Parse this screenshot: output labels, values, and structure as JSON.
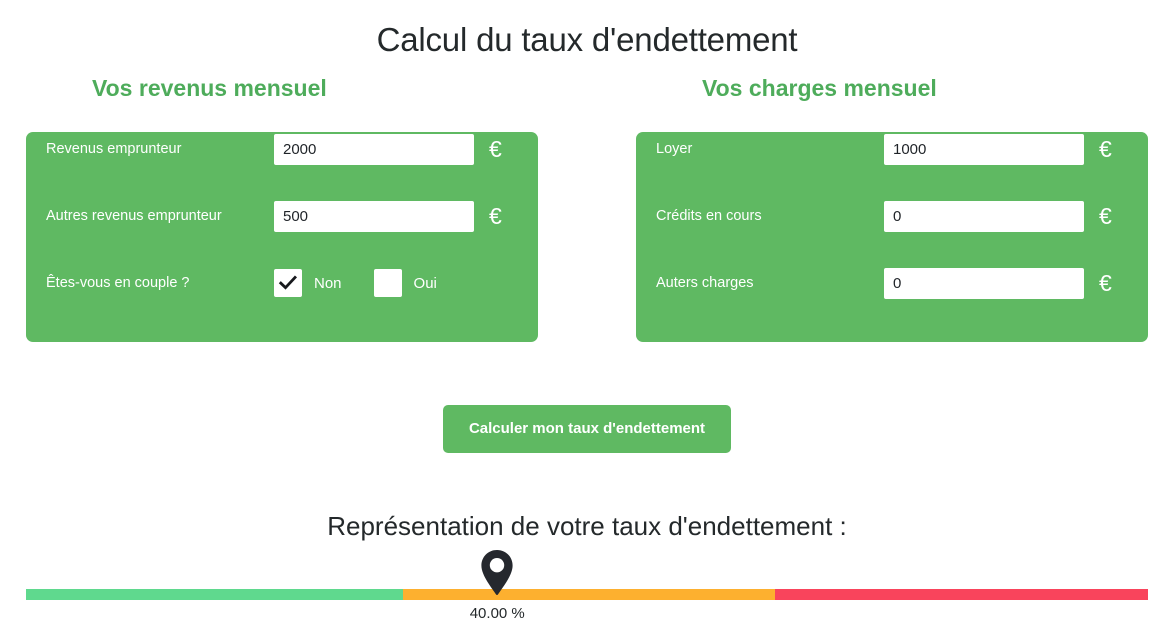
{
  "page": {
    "title": "Calcul du taux d'endettement"
  },
  "income_panel": {
    "legend": "Vos revenus mensuel",
    "fields": [
      {
        "label": "Revenus emprunteur",
        "value": "2000",
        "unit": "€"
      },
      {
        "label": "Autres revenus emprunteur",
        "value": "500",
        "unit": "€"
      }
    ],
    "couple_question": {
      "label": "Êtes-vous en couple ?",
      "options": [
        {
          "label": "Non",
          "checked": true
        },
        {
          "label": "Oui",
          "checked": false
        }
      ]
    }
  },
  "charges_panel": {
    "legend": "Vos charges mensuel",
    "fields": [
      {
        "label": "Loyer",
        "value": "1000",
        "unit": "€"
      },
      {
        "label": "Crédits en cours",
        "value": "0",
        "unit": "€"
      },
      {
        "label": "Auters charges",
        "value": "0",
        "unit": "€"
      }
    ]
  },
  "actions": {
    "calculate_label": "Calculer mon taux d'endettement"
  },
  "result": {
    "title": "Représentation de votre taux d'endettement :",
    "value_label": "40.00 %"
  },
  "chart_data": {
    "type": "bar",
    "title": "Représentation de votre taux d'endettement :",
    "orientation": "horizontal",
    "marker_value": 40.0,
    "marker_label": "40.00 %",
    "marker_position_pct": 42,
    "unit": "%",
    "xlim": [
      0,
      100
    ],
    "grid": false,
    "legend": "none",
    "segments": [
      {
        "name": "zone-verte",
        "start_pct": 0,
        "end_pct": 33.6,
        "color": "#5fd98e"
      },
      {
        "name": "zone-orange",
        "start_pct": 33.6,
        "end_pct": 66.8,
        "color": "#fdb02f"
      },
      {
        "name": "zone-rouge",
        "start_pct": 66.8,
        "end_pct": 100,
        "color": "#f9445c"
      }
    ]
  },
  "colors": {
    "panel_green": "#5fb962",
    "legend_green": "#4eac5b",
    "gauge_green": "#5fd98e",
    "gauge_orange": "#fdb02f",
    "gauge_red": "#f9445c",
    "pin": "#25282e",
    "text_dark": "#24292b"
  }
}
